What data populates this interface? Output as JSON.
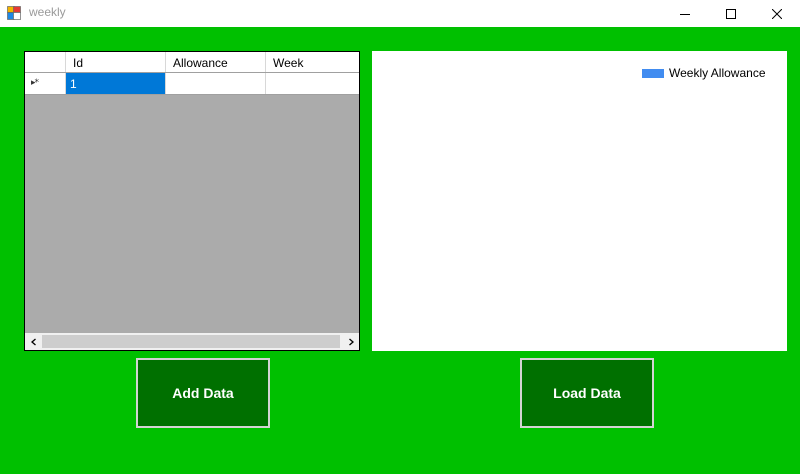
{
  "window": {
    "title": "weekly",
    "icon": "winforms-app-icon",
    "controls": [
      "minimize-icon",
      "maximize-icon",
      "close-icon"
    ]
  },
  "grid": {
    "columns": [
      "Id",
      "Allowance",
      "Week"
    ],
    "rows": [
      {
        "row_header_glyph": "▸*",
        "cells": [
          "1",
          "",
          ""
        ]
      }
    ],
    "selected_cell": {
      "row": 0,
      "col": 0
    },
    "scroll_left_glyph": "‹",
    "scroll_right_glyph": "›"
  },
  "chart": {
    "legend": [
      {
        "name": "Weekly Allowance",
        "color": "#418cf0"
      }
    ]
  },
  "buttons": {
    "add": "Add Data",
    "load": "Load Data"
  },
  "colors": {
    "client_bg": "#00c000",
    "button_bg": "#007000",
    "selection": "#0078d7",
    "grid_bg": "#ababab"
  }
}
